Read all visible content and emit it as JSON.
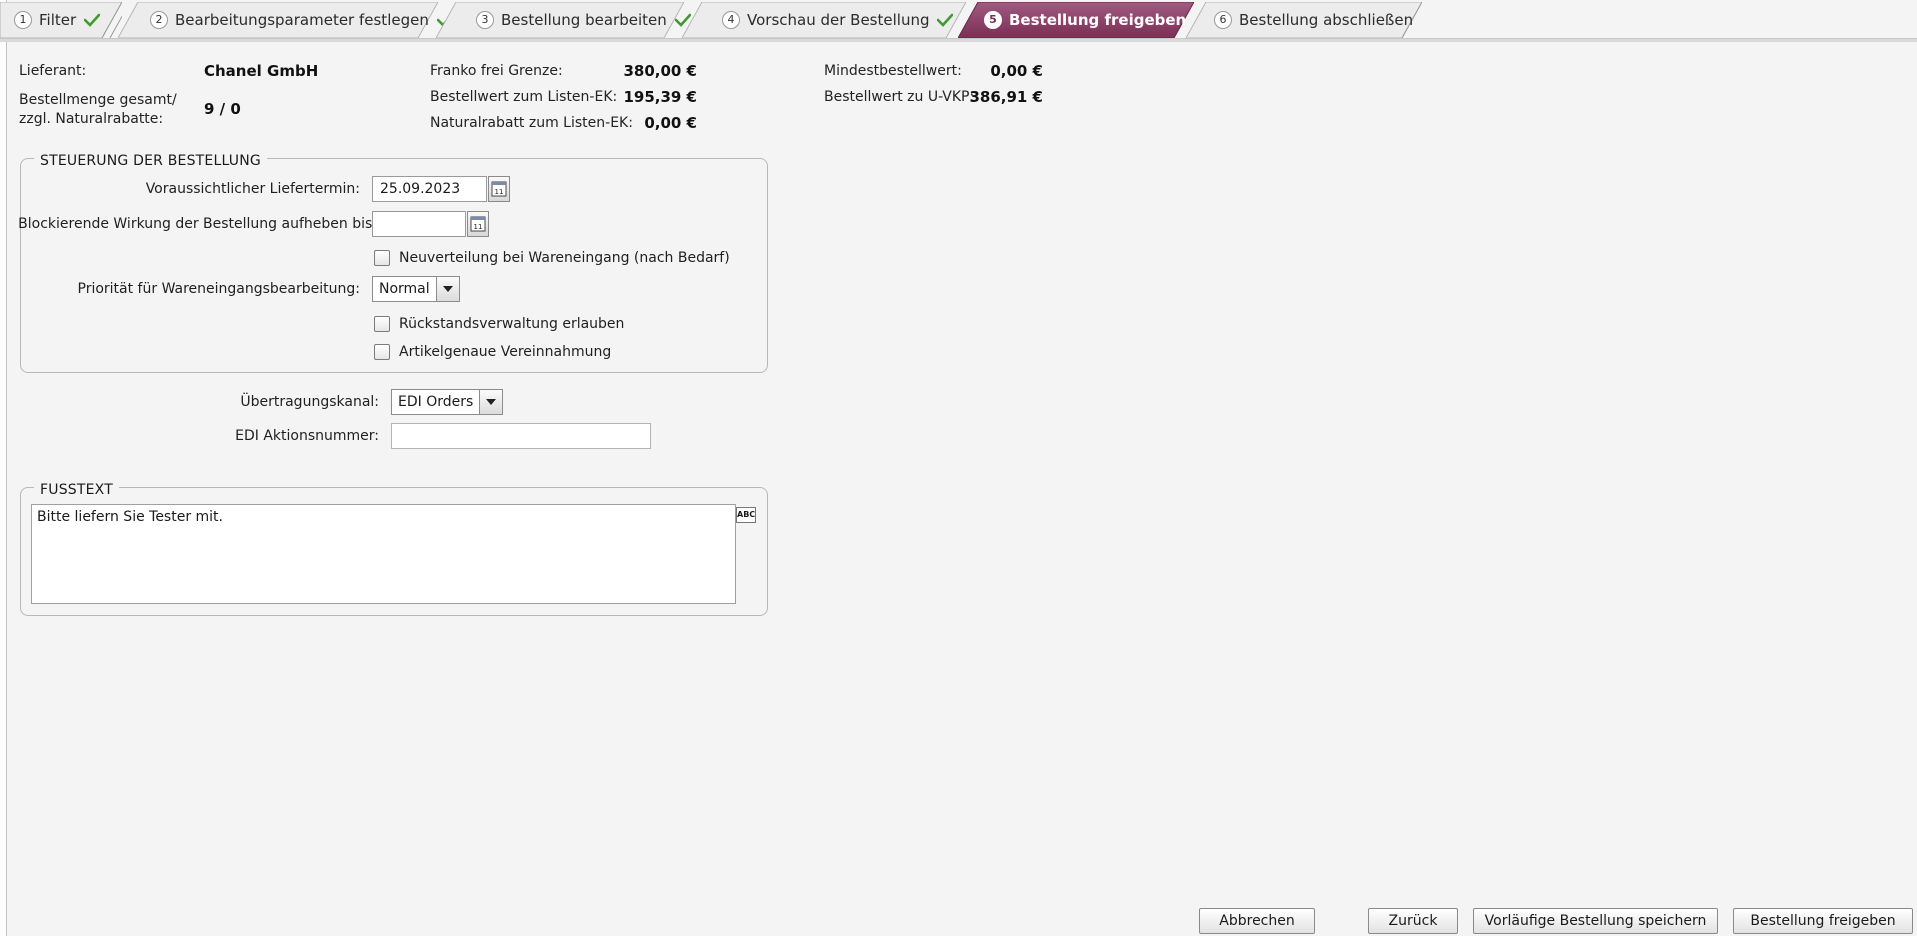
{
  "wizard": {
    "steps": [
      {
        "num": "1",
        "label": "Filter",
        "done": true
      },
      {
        "num": "2",
        "label": "Bearbeitungsparameter festlegen",
        "done": true
      },
      {
        "num": "3",
        "label": "Bestellung bearbeiten",
        "done": true
      },
      {
        "num": "4",
        "label": "Vorschau der Bestellung",
        "done": true
      },
      {
        "num": "5",
        "label": "Bestellung freigeben",
        "active": true
      },
      {
        "num": "6",
        "label": "Bestellung abschließen"
      }
    ]
  },
  "summary": {
    "supplier_label": "Lieferant:",
    "supplier_value": "Chanel GmbH",
    "quantity_label_line1": "Bestellmenge gesamt/",
    "quantity_label_line2": "zzgl. Naturalrabatte:",
    "quantity_value": "9 / 0",
    "franko_label": "Franko frei Grenze:",
    "franko_value": "380,00 €",
    "order_value_ek_label": "Bestellwert zum Listen-EK:",
    "order_value_ek_value": "195,39 €",
    "natural_discount_label": "Naturalrabatt zum Listen-EK:",
    "natural_discount_value": "0,00 €",
    "min_order_label": "Mindestbestellwert:",
    "min_order_value": "0,00 €",
    "order_value_uvkp_label": "Bestellwert zu U-VKP:",
    "order_value_uvkp_value": "386,91 €"
  },
  "control": {
    "title": "STEUERUNG DER BESTELLUNG",
    "delivery_date_label": "Voraussichtlicher Liefertermin:",
    "delivery_date_value": "25.09.2023",
    "blocking_label": "Blockierende Wirkung der Bestellung aufheben bis:",
    "blocking_value": "",
    "redistribution_label": "Neuverteilung bei Wareneingang (nach Bedarf)",
    "priority_label": "Priorität für Wareneingangsbearbeitung:",
    "priority_value": "Normal",
    "backorder_label": "Rückstandsverwaltung erlauben",
    "article_receipt_label": "Artikelgenaue Vereinnahmung"
  },
  "transmission": {
    "channel_label": "Übertragungskanal:",
    "channel_value": "EDI Orders",
    "edi_action_label": "EDI Aktionsnummer:",
    "edi_action_value": ""
  },
  "footer_text": {
    "title": "FUSSTEXT",
    "value": "Bitte liefern Sie Tester mit.",
    "spell_icon_text": "ABC"
  },
  "buttons": {
    "cancel": "Abbrechen",
    "back": "Zurück",
    "save_draft": "Vorläufige Bestellung speichern",
    "release": "Bestellung freigeben"
  },
  "colors": {
    "active_step": "#8a3d63",
    "check": "#3f9a2f"
  }
}
